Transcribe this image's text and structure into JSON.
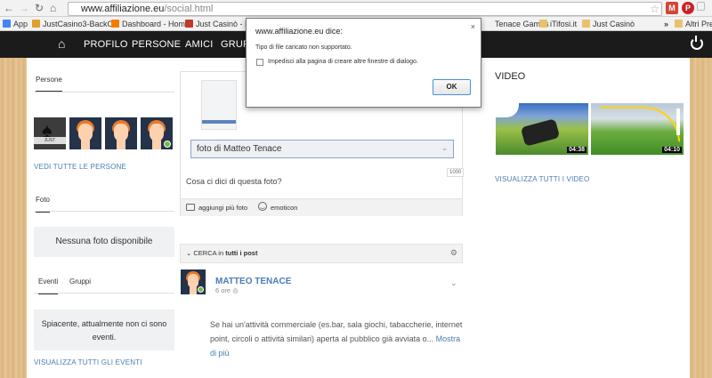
{
  "browser": {
    "url_host": "www.affiliazione.eu",
    "url_path": "/social.html",
    "bookmarks": [
      "App",
      "JustCasino3-BackOff:",
      "Dashboard - Home",
      "Just Casinò - Il ca",
      "Tenace Games",
      "iTifosi.it",
      "Just Casinò",
      "Altri Pre"
    ],
    "more_bookmarks": "»"
  },
  "nav": {
    "items": [
      "PROFILO",
      "PERSONE",
      "AMICI",
      "GRUPP"
    ]
  },
  "left": {
    "persone_tab": "Persone",
    "persone_link": "VEDI TUTTE LE PERSONE",
    "foto_tab": "Foto",
    "foto_empty": "Nessuna foto disponibile",
    "eventi_tab": "Eventi",
    "gruppi_tab": "Gruppi",
    "eventi_empty": "Spiacente, attualmente non ci sono eventi.",
    "eventi_link": "VISUALIZZA TUTTI GLI EVENTI",
    "avatar_logo_text": "JUST"
  },
  "composer": {
    "album_select": "foto di Matteo Tenace",
    "counter": "1000",
    "placeholder": "Cosa ci dici di questa foto?",
    "add_photos": "aggiungi più foto",
    "emoticon": "emoticon"
  },
  "feed": {
    "search_label": "CERCA in",
    "search_scope": "tutti i post",
    "post": {
      "author": "MATTEO TENACE",
      "time": "6 ore",
      "text": "Se hai un'attività commerciale (es.bar, sala giochi, tabaccherie, internet point, circoli o attività similari) aperta al pubblico già avviata o...",
      "more": "Mostra di più"
    }
  },
  "video": {
    "title": "VIDEO",
    "durations": [
      "04:38",
      "04:10"
    ],
    "link": "VISUALIZZA TUTTI I VIDEO"
  },
  "dialog": {
    "title": "www.affiliazione.eu dice:",
    "message": "Tipo di file caricato non supportato.",
    "checkbox_label": "Impedisci alla pagina di creare altre finestre di dialogo.",
    "ok": "OK",
    "close": "×"
  },
  "colors": {
    "navbar": "#1b1b1b",
    "link": "#4a7cb5",
    "online": "#6dbb3c"
  }
}
